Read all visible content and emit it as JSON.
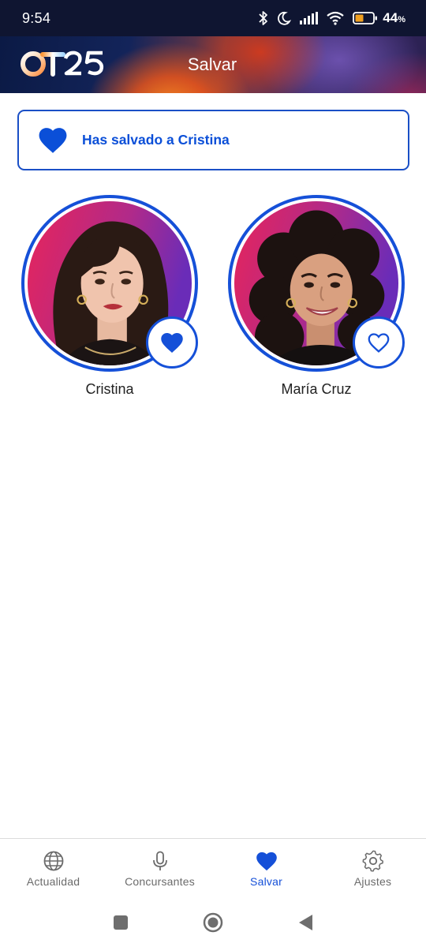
{
  "status_bar": {
    "time": "9:54",
    "battery_percent": "44",
    "battery_unit": "%",
    "icons": [
      "bluetooth-icon",
      "moon-icon",
      "signal-icon",
      "wifi-icon",
      "battery-icon"
    ]
  },
  "header": {
    "logo_text": "OT25",
    "title": "Salvar"
  },
  "banner": {
    "text": "Has salvado a Cristina",
    "icon": "heart-filled-icon"
  },
  "contestants": [
    {
      "name": "Cristina",
      "saved": true
    },
    {
      "name": "María Cruz",
      "saved": false
    }
  ],
  "bottom_nav": {
    "items": [
      {
        "label": "Actualidad",
        "icon": "globe-icon",
        "active": false
      },
      {
        "label": "Concursantes",
        "icon": "microphone-icon",
        "active": false
      },
      {
        "label": "Salvar",
        "icon": "heart-icon",
        "active": true
      },
      {
        "label": "Ajustes",
        "icon": "gear-icon",
        "active": false
      }
    ]
  },
  "colors": {
    "accent": "#1550d8",
    "banner_text": "#0b4fd8",
    "status_bar": "#0f1531"
  }
}
